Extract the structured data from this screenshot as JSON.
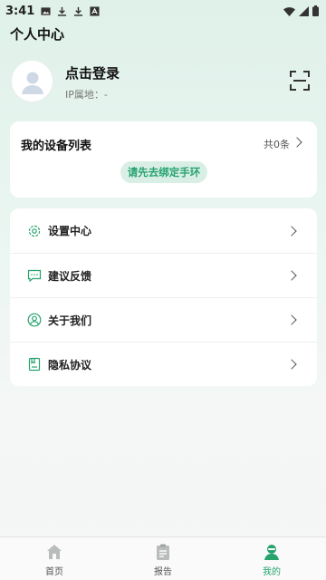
{
  "status_bar": {
    "time": "3:41"
  },
  "header": {
    "title": "个人中心"
  },
  "profile": {
    "login_label": "点击登录",
    "ip_label": "IP属地：-"
  },
  "devices": {
    "title": "我的设备列表",
    "count": "共0条",
    "bind_label": "请先去绑定手环"
  },
  "menu": {
    "items": [
      {
        "label": "设置中心",
        "icon": "gear-icon"
      },
      {
        "label": "建议反馈",
        "icon": "feedback-icon"
      },
      {
        "label": "关于我们",
        "icon": "user-circle-icon"
      },
      {
        "label": "隐私协议",
        "icon": "document-icon"
      }
    ]
  },
  "tabbar": {
    "tabs": [
      {
        "label": "首页",
        "icon": "home-icon"
      },
      {
        "label": "报告",
        "icon": "report-icon"
      },
      {
        "label": "我的",
        "icon": "profile-icon",
        "active": true
      }
    ]
  },
  "colors": {
    "accent": "#27a36e",
    "accent_bg": "#d9efe6",
    "bg_top": "#dff1e9"
  }
}
